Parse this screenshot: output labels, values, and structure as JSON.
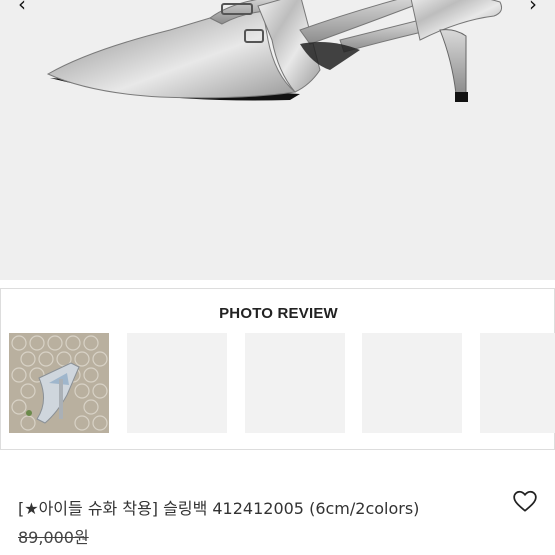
{
  "hero": {
    "image_alt": "silver pointed-toe slingback heel",
    "prev_icon": "chevron-left-icon",
    "next_icon": "chevron-right-icon",
    "prev_glyph": "‹",
    "next_glyph": "›"
  },
  "photo_review": {
    "title": "PHOTO REVIEW",
    "thumbnails": [
      {
        "name": "review-photo-1",
        "has_image": true
      },
      {
        "name": "review-photo-2",
        "has_image": false
      },
      {
        "name": "review-photo-3",
        "has_image": false
      },
      {
        "name": "review-photo-4",
        "has_image": false
      },
      {
        "name": "review-photo-5",
        "has_image": false
      }
    ]
  },
  "product": {
    "name": "[★아이들 슈화 착용] 슬링백 412412005 (6cm/2colors)",
    "original_price": "89,000원",
    "wishlist_icon": "heart-outline-icon"
  },
  "colors": {
    "hero_bg": "#efefef",
    "border": "#dddddd",
    "text": "#333333"
  }
}
